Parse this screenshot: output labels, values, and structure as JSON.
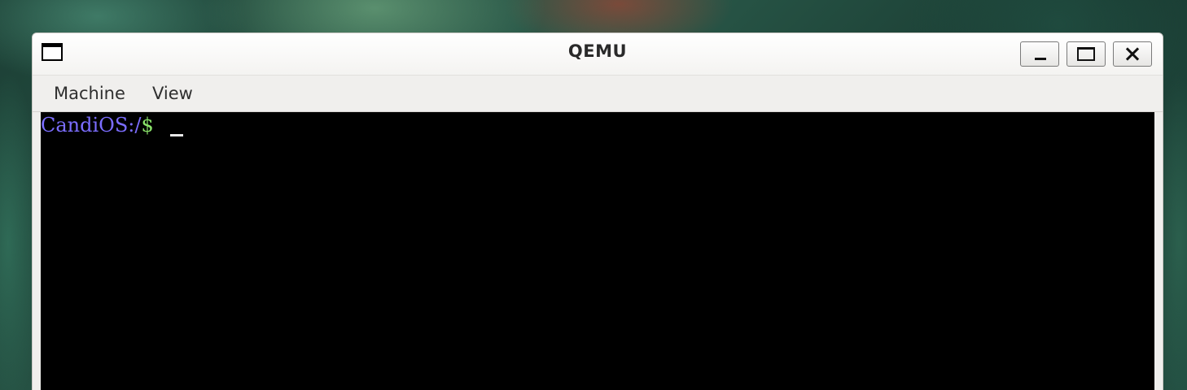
{
  "window": {
    "title": "QEMU"
  },
  "menubar": {
    "items": [
      {
        "label": "Machine"
      },
      {
        "label": "View"
      }
    ]
  },
  "terminal": {
    "prompt_host": "CandiOS:/",
    "prompt_symbol": "$",
    "input": "",
    "colors": {
      "background": "#000000",
      "host": "#7b6dff",
      "symbol": "#8ae36a",
      "cursor": "#e8e8e8"
    }
  },
  "icons": {
    "app": "window-icon",
    "minimize": "minimize-icon",
    "maximize": "maximize-icon",
    "close": "close-icon"
  }
}
